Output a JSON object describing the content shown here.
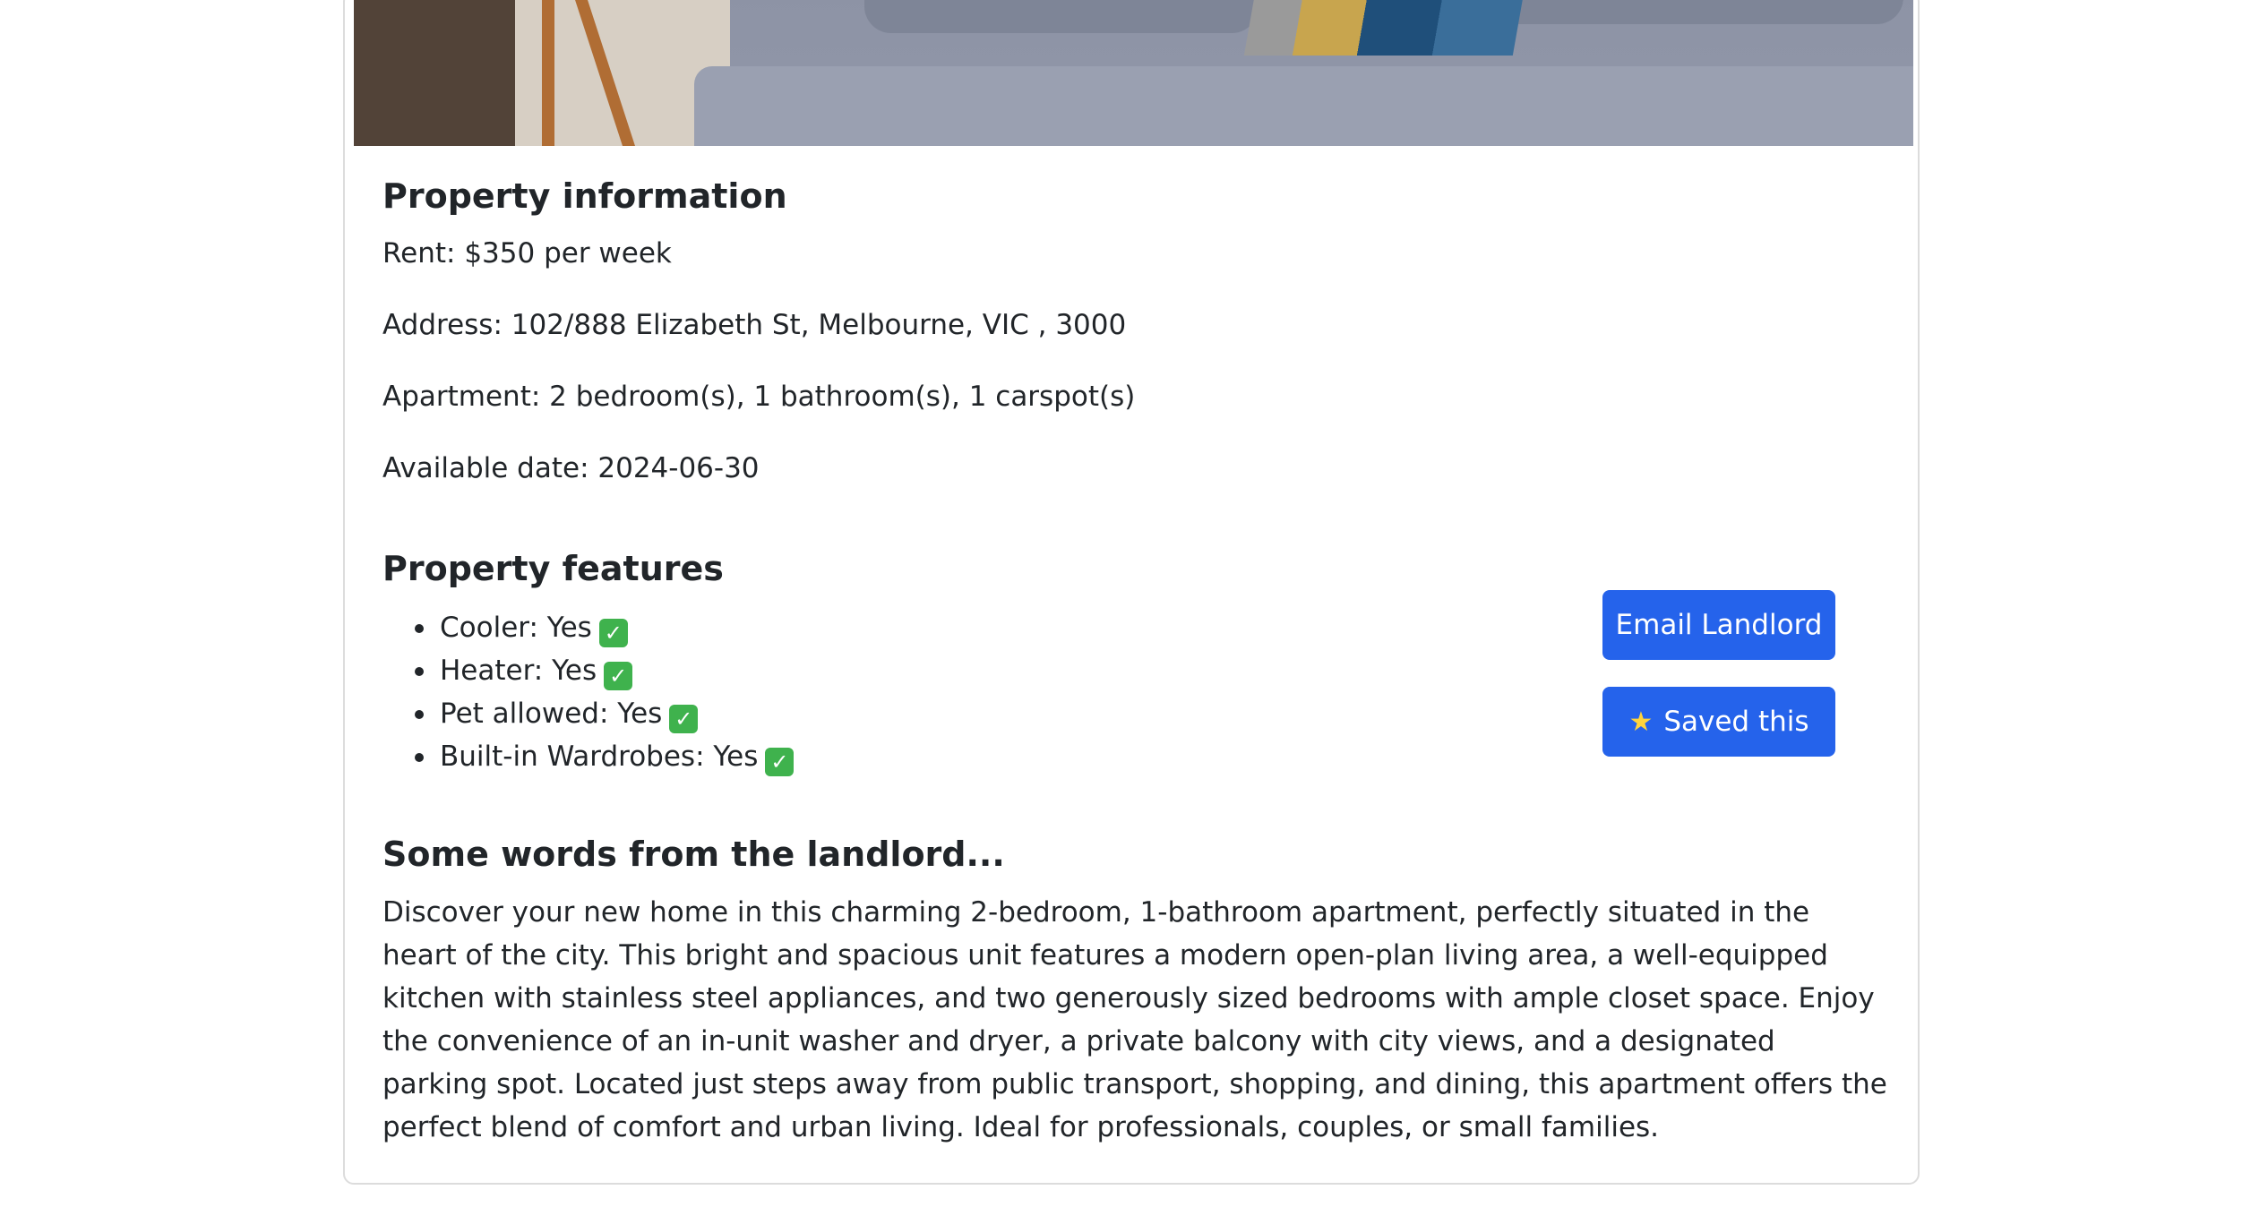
{
  "info": {
    "title": "Property information",
    "rent": "Rent: $350 per week",
    "address": "Address: 102/888 Elizabeth St, Melbourne, VIC , 3000",
    "apartment": "Apartment: 2 bedroom(s), 1 bathroom(s), 1 carspot(s)",
    "available": "Available date: 2024-06-30"
  },
  "features": {
    "title": "Property features",
    "items": [
      {
        "label": "Cooler: Yes",
        "icon": "check-icon"
      },
      {
        "label": "Heater: Yes",
        "icon": "check-icon"
      },
      {
        "label": "Pet allowed: Yes",
        "icon": "check-icon"
      },
      {
        "label": "Built-in Wardrobes: Yes",
        "icon": "check-icon"
      }
    ]
  },
  "actions": {
    "email_label": "Email Landlord",
    "saved_label": "Saved this",
    "saved_icon": "star-icon",
    "button_color": "#2563eb"
  },
  "landlord": {
    "title": "Some words from the landlord...",
    "text": "Discover your new home in this charming 2-bedroom, 1-bathroom apartment, perfectly situated in the heart of the city. This bright and spacious unit features a modern open-plan living area, a well-equipped kitchen with stainless steel appliances, and two generously sized bedrooms with ample closet space. Enjoy the convenience of an in-unit washer and dryer, a private balcony with city views, and a designated parking spot. Located just steps away from public transport, shopping, and dining, this apartment offers the perfect blend of comfort and urban living. Ideal for professionals, couples, or small families."
  }
}
